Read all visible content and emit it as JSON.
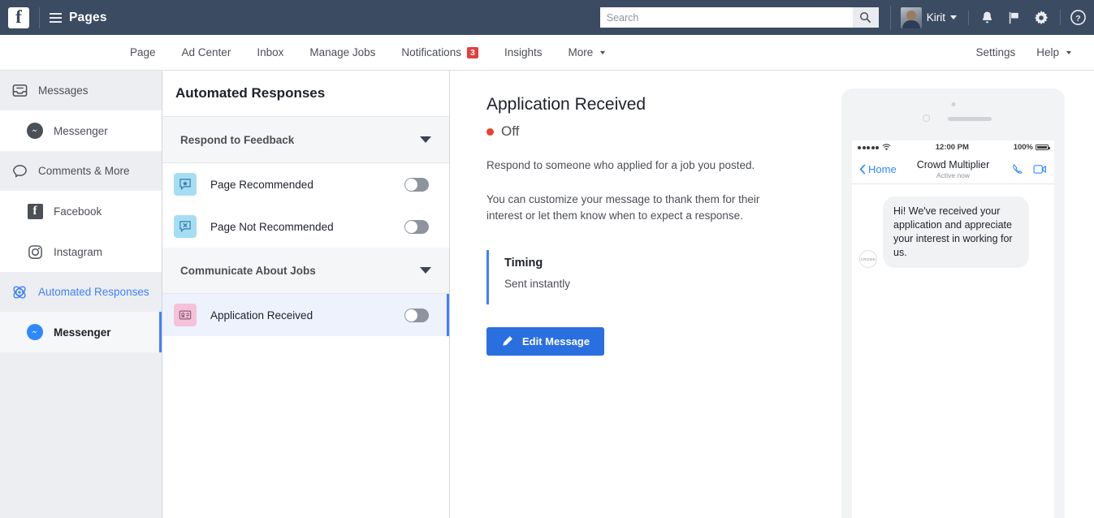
{
  "topbar": {
    "logo_letter": "f",
    "menu_icon": "hamburger-icon",
    "app_title": "Pages",
    "search_placeholder": "Search",
    "search_value": "",
    "user_name": "Kirit",
    "icons": [
      "bell-icon",
      "flag-icon",
      "gear-icon",
      "help-icon"
    ]
  },
  "navbar": {
    "items": [
      {
        "label": "Page"
      },
      {
        "label": "Ad Center"
      },
      {
        "label": "Inbox"
      },
      {
        "label": "Manage Jobs"
      },
      {
        "label": "Notifications",
        "badge": "3"
      },
      {
        "label": "Insights"
      },
      {
        "label": "More",
        "caret": true
      }
    ],
    "right_items": [
      {
        "label": "Settings"
      },
      {
        "label": "Help",
        "caret": true
      }
    ]
  },
  "sidebar": {
    "sections": [
      {
        "label": "Messages",
        "icon": "inbox-icon",
        "accent": false
      },
      {
        "label": "Comments & More",
        "icon": "comment-icon",
        "accent": false
      },
      {
        "label": "Automated Responses",
        "icon": "atom-icon",
        "accent": true
      }
    ],
    "items": [
      {
        "label": "Messenger",
        "icon": "messenger-icon",
        "selected": false
      },
      {
        "label": "Facebook",
        "icon": "facebook-icon",
        "selected": false
      },
      {
        "label": "Instagram",
        "icon": "instagram-icon",
        "selected": false
      },
      {
        "label": "Messenger",
        "icon": "messenger-icon",
        "selected": true
      }
    ]
  },
  "middle": {
    "header_title": "Automated Responses",
    "groups": [
      {
        "title": "Respond to Feedback",
        "rows": [
          {
            "label": "Page Recommended",
            "icon": "speech-star-icon",
            "tile": "blue",
            "toggle": "off",
            "selected": false
          },
          {
            "label": "Page Not Recommended",
            "icon": "speech-x-icon",
            "tile": "blue",
            "toggle": "off",
            "selected": false
          }
        ]
      },
      {
        "title": "Communicate About Jobs",
        "rows": [
          {
            "label": "Application Received",
            "icon": "id-card-icon",
            "tile": "pink",
            "toggle": "off",
            "selected": true
          }
        ]
      }
    ]
  },
  "detail": {
    "title": "Application Received",
    "status": "Off",
    "status_color": "#e8432f",
    "paragraph1": "Respond to someone who applied for a job you posted.",
    "paragraph2": "You can customize your message to thank them for their interest or let them know when to expect a response.",
    "timing_label": "Timing",
    "timing_value": "Sent instantly",
    "edit_button": "Edit Message"
  },
  "preview": {
    "status_time": "12:00 PM",
    "battery": "100%",
    "back_label": "Home",
    "contact_name": "Crowd Multiplier",
    "contact_status": "Active now",
    "avatar_text": "CROWD",
    "message": "Hi! We've received your application and appreciate your interest in working for us."
  },
  "colors": {
    "topbar_bg": "#3b4b61",
    "accent_blue": "#4080ff",
    "button_blue": "#2a6fe0",
    "status_red": "#e8432f",
    "badge_red": "#e53e3e",
    "tile_blue": "#a5def2",
    "tile_pink": "#f6c2d9",
    "selected_row": "#edf2fd"
  }
}
